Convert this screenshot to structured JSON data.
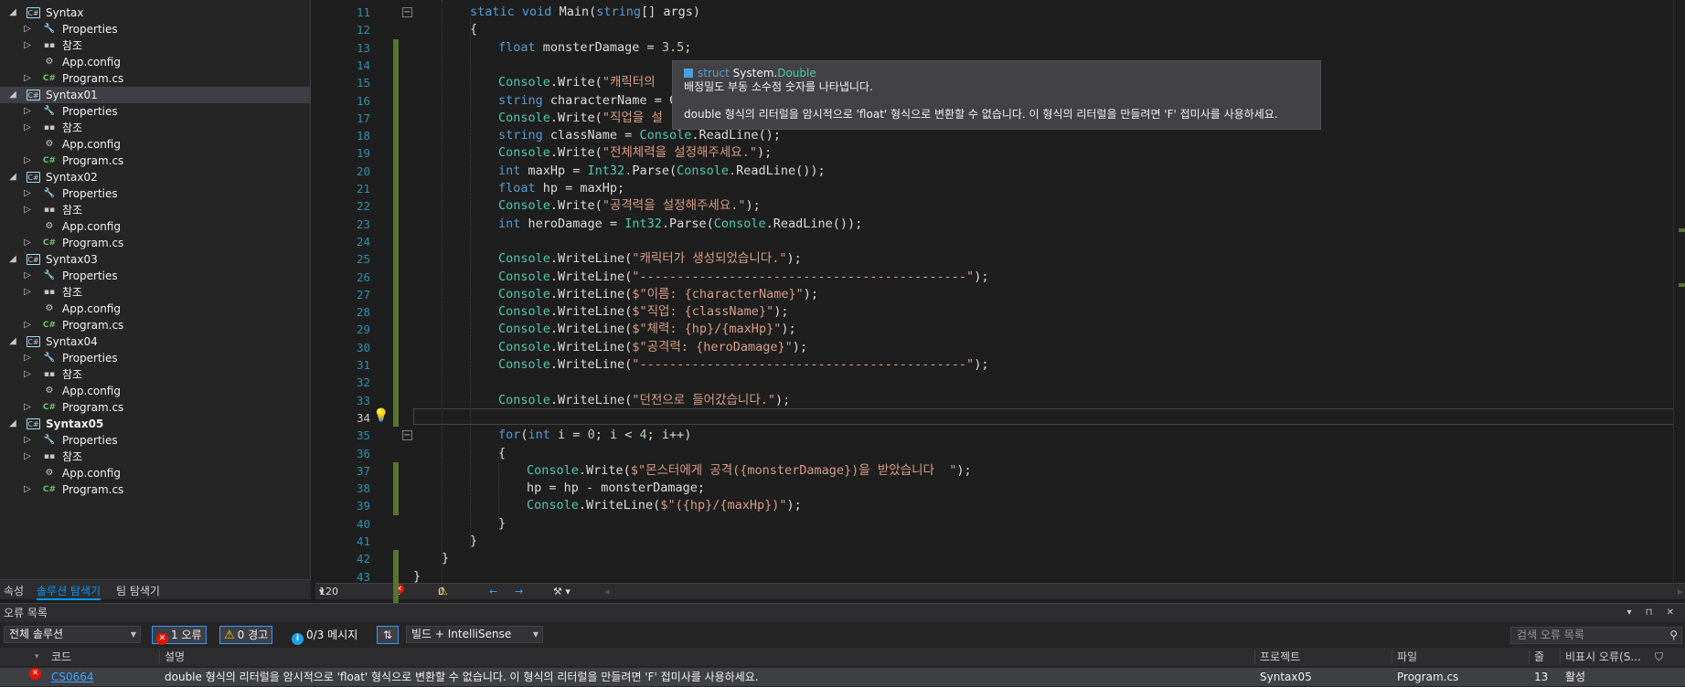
{
  "solution_explorer": {
    "projects": [
      {
        "name": "Syntax",
        "children": [
          "Properties",
          "참조",
          "App.config",
          "Program.cs"
        ]
      },
      {
        "name": "Syntax01",
        "children": [
          "Properties",
          "참조",
          "App.config",
          "Program.cs"
        ]
      },
      {
        "name": "Syntax02",
        "children": [
          "Properties",
          "참조",
          "App.config",
          "Program.cs"
        ]
      },
      {
        "name": "Syntax03",
        "children": [
          "Properties",
          "참조",
          "App.config",
          "Program.cs"
        ]
      },
      {
        "name": "Syntax04",
        "children": [
          "Properties",
          "참조",
          "App.config",
          "Program.cs"
        ]
      },
      {
        "name": "Syntax05",
        "children": [
          "Properties",
          "참조",
          "App.config",
          "Program.cs"
        ]
      }
    ],
    "bottom_tabs": [
      "속성",
      "솔루션 탐색기",
      "팀 탐색기"
    ]
  },
  "editor": {
    "line_numbers": [
      "11",
      "12",
      "13",
      "14",
      "15",
      "16",
      "17",
      "18",
      "19",
      "20",
      "21",
      "22",
      "23",
      "24",
      "25",
      "26",
      "27",
      "28",
      "29",
      "30",
      "31",
      "32",
      "33",
      "34",
      "35",
      "36",
      "37",
      "38",
      "39",
      "40",
      "41",
      "42",
      "43"
    ],
    "lines": [
      "static void Main(string[] args)",
      "{",
      "float monsterDamage = 3.5;",
      "",
      "Console.Write(\"캐릭터의",
      "string characterName = C",
      "Console.Write(\"직업을 설",
      "string className = Console.ReadLine();",
      "Console.Write(\"전체체력을 설정해주세요.\");",
      "int maxHp = Int32.Parse(Console.ReadLine());",
      "float hp = maxHp;",
      "Console.Write(\"공격력을 설정해주세요.\");",
      "int heroDamage = Int32.Parse(Console.ReadLine());",
      "",
      "Console.WriteLine(\"캐릭터가 생성되었습니다.\");",
      "Console.WriteLine(\"--------------------------------------------\");",
      "Console.WriteLine($\"이름: {characterName}\");",
      "Console.WriteLine($\"직업: {className}\");",
      "Console.WriteLine($\"체력: {hp}/{maxHp}\");",
      "Console.WriteLine($\"공격력: {heroDamage}\");",
      "Console.WriteLine(\"--------------------------------------------\");",
      "",
      "Console.WriteLine(\"던전으로 들어갔습니다.\");",
      "",
      "for(int i = 0; i < 4; i++)",
      "{",
      "Console.Write($\"몬스터에게 공격({monsterDamage})을 받았습니다  \");",
      "hp = hp - monsterDamage;",
      "Console.WriteLine($\"({hp}/{maxHp})\");",
      "}",
      "}",
      "}",
      "}"
    ],
    "tooltip": {
      "keyword": "struct",
      "namespace": "System.",
      "type": "Double",
      "summary": "배정밀도 부동 소수점 숫자를 나타냅니다.",
      "error": "double 형식의 리터럴을 암시적으로 'float' 형식으로 변환할 수 없습니다. 이 형식의 리터럴을 만들려면 'F' 접미사를 사용하세요."
    },
    "status": {
      "zoom": "120 %",
      "errors": "1",
      "warnings": "0"
    }
  },
  "error_list": {
    "title": "오류 목록",
    "scope": "전체 솔루션",
    "errors_btn": "1 오류",
    "warnings_btn": "0 경고",
    "messages_btn": "0/3 메시지",
    "build_filter": "빌드 + IntelliSense",
    "search_placeholder": "검색 오류 목록",
    "columns": {
      "code": "코드",
      "description": "설명",
      "project": "프로젝트",
      "file": "파일",
      "line": "줄",
      "suppression": "비표시 오류(S..."
    },
    "rows": [
      {
        "code": "CS0664",
        "description": "double 형식의 리터럴을 암시적으로 'float' 형식으로 변환할 수 없습니다. 이 형식의 리터럴을 만들려면 'F' 접미사를 사용하세요.",
        "project": "Syntax05",
        "file": "Program.cs",
        "line": "13",
        "suppression": "활성"
      }
    ]
  },
  "colors": {
    "accent": "#0097fb",
    "error": "#e51400",
    "warning": "#ffcc00",
    "keyword": "#569cd6",
    "type": "#4ec9b0",
    "string": "#d69d85"
  }
}
